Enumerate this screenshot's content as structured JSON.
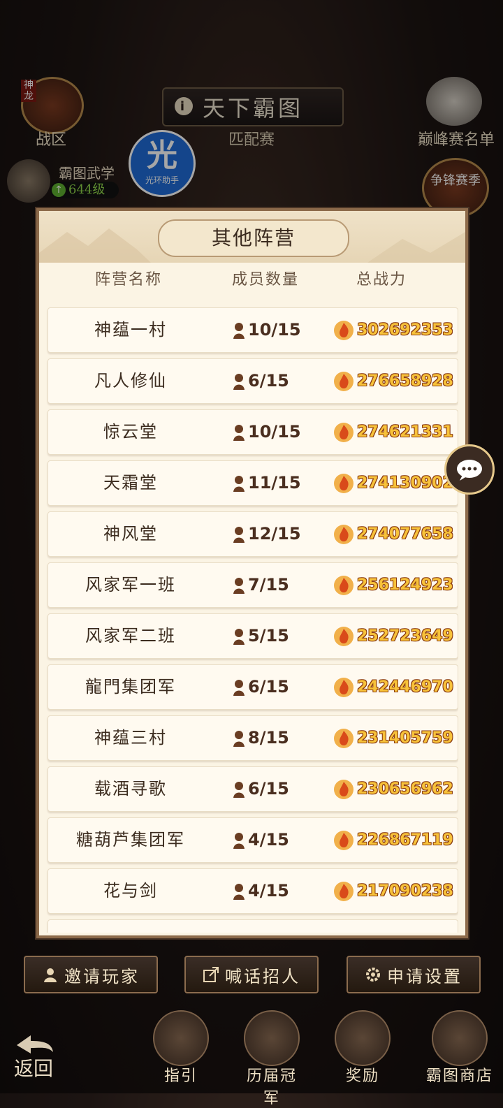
{
  "top": {
    "title": "天下霸图",
    "subtitle": "匹配赛",
    "left_corner_label": "战区",
    "left_corner_badge": "神龙",
    "right_corner_label": "巅峰赛名单",
    "wuxue_label": "霸图武学",
    "wuxue_level": "644级",
    "right_event_label": "争锋赛季"
  },
  "helper_badge": {
    "glyph": "光",
    "caption": "光环助手"
  },
  "modal": {
    "title": "其他阵营",
    "columns": [
      "阵营名称",
      "成员数量",
      "总战力"
    ],
    "rows": [
      {
        "name": "神蕴一村",
        "members": "10/15",
        "power": "302692353"
      },
      {
        "name": "凡人修仙",
        "members": "6/15",
        "power": "276658928"
      },
      {
        "name": "惊云堂",
        "members": "10/15",
        "power": "274621331"
      },
      {
        "name": "天霜堂",
        "members": "11/15",
        "power": "274130902"
      },
      {
        "name": "神风堂",
        "members": "12/15",
        "power": "274077658"
      },
      {
        "name": "风家军一班",
        "members": "7/15",
        "power": "256124923"
      },
      {
        "name": "风家军二班",
        "members": "5/15",
        "power": "252723649"
      },
      {
        "name": "龍門集团军",
        "members": "6/15",
        "power": "242446970"
      },
      {
        "name": "神蕴三村",
        "members": "8/15",
        "power": "231405759"
      },
      {
        "name": "载酒寻歌",
        "members": "6/15",
        "power": "230656962"
      },
      {
        "name": "糖葫芦集团军",
        "members": "4/15",
        "power": "226867119"
      },
      {
        "name": "花与剑",
        "members": "4/15",
        "power": "217090238"
      }
    ]
  },
  "bottom_buttons": {
    "invite": "邀请玩家",
    "shout": "喊话招人",
    "apply_settings": "申请设置"
  },
  "nav": {
    "back": "返回",
    "guide": "指引",
    "champions": "历届冠军",
    "rewards": "奖励",
    "shop": "霸图商店"
  },
  "colors": {
    "power_text": "#f7c23a",
    "modal_bg": "#fbf4e4",
    "helper_blue": "#1f6bd6"
  }
}
